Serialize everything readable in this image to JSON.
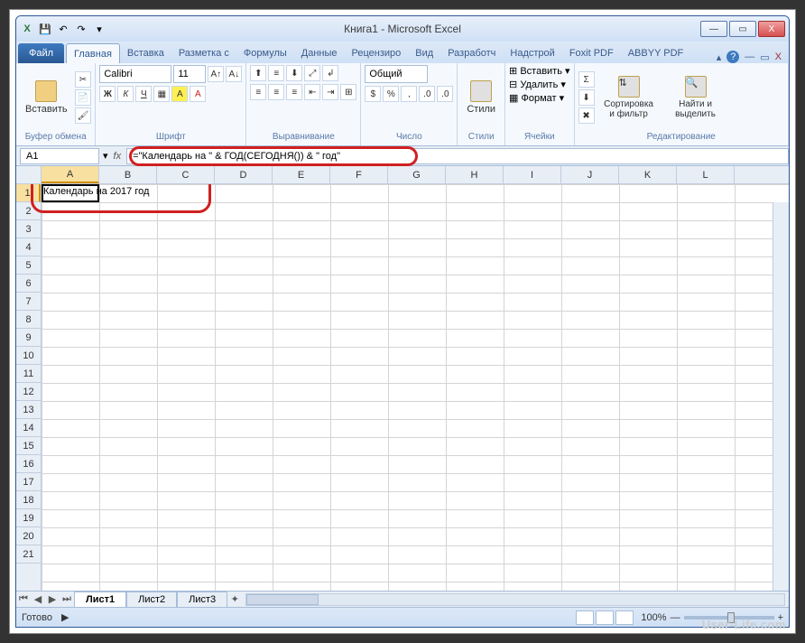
{
  "window": {
    "title": "Книга1 - Microsoft Excel"
  },
  "qat": {
    "excel": "X",
    "save": "💾",
    "undo": "↶",
    "redo": "↷"
  },
  "winctrl": {
    "min": "—",
    "max": "▭",
    "close": "X"
  },
  "tabs": {
    "file": "Файл",
    "home": "Главная",
    "insert": "Вставка",
    "layout": "Разметка с",
    "formulas": "Формулы",
    "data": "Данные",
    "review": "Рецензиро",
    "view": "Вид",
    "developer": "Разработч",
    "addins": "Надстрой",
    "foxit": "Foxit PDF",
    "abbyy": "ABBYY PDF"
  },
  "ribbon": {
    "clipboard": {
      "paste": "Вставить",
      "label": "Буфер обмена"
    },
    "font": {
      "name": "Calibri",
      "size": "11",
      "label": "Шрифт",
      "bold": "Ж",
      "italic": "К",
      "underline": "Ч"
    },
    "align": {
      "label": "Выравнивание",
      "wrap": "Перенос"
    },
    "number": {
      "format": "Общий",
      "label": "Число"
    },
    "styles": {
      "label": "Стили",
      "btn": "Стили"
    },
    "cells": {
      "insert": "Вставить",
      "delete": "Удалить",
      "format": "Формат",
      "label": "Ячейки"
    },
    "editing": {
      "sort": "Сортировка и фильтр",
      "find": "Найти и выделить",
      "label": "Редактирование",
      "sigma": "Σ",
      "fill": "⬇",
      "clear": "✖"
    }
  },
  "namebox": "A1",
  "fx": "fx",
  "formula": "=\"Календарь на \" & ГОД(СЕГОДНЯ()) & \" год\"",
  "columns": [
    "A",
    "B",
    "C",
    "D",
    "E",
    "F",
    "G",
    "H",
    "I",
    "J",
    "K",
    "L"
  ],
  "rows": [
    "1",
    "2",
    "3",
    "4",
    "5",
    "6",
    "7",
    "8",
    "9",
    "10",
    "11",
    "12",
    "13",
    "14",
    "15",
    "16",
    "17",
    "18",
    "19",
    "20",
    "21"
  ],
  "cellA1": "Календарь на 2017 год",
  "sheets": {
    "s1": "Лист1",
    "s2": "Лист2",
    "s3": "Лист3"
  },
  "status": {
    "ready": "Готово",
    "zoom": "100%",
    "minus": "—",
    "plus": "+"
  },
  "watermark": "User-Life.com",
  "icons": {
    "dd": "▾",
    "help": "?",
    "up": "▴"
  }
}
